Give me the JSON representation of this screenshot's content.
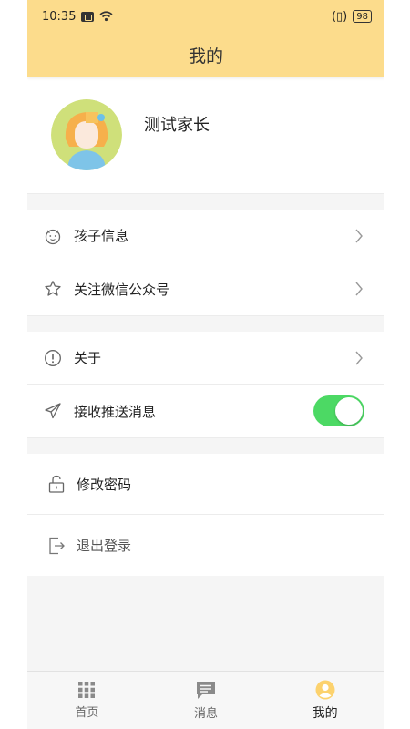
{
  "status_bar": {
    "time": "10:35",
    "battery": "98"
  },
  "header": {
    "title": "我的"
  },
  "profile": {
    "name": "测试家长"
  },
  "menu_group_1": [
    {
      "label": "孩子信息",
      "icon": "child-face-icon"
    },
    {
      "label": "关注微信公众号",
      "icon": "star-icon"
    }
  ],
  "menu_group_2": [
    {
      "label": "关于",
      "icon": "info-exclamation-icon"
    },
    {
      "label": "接收推送消息",
      "icon": "paper-plane-icon",
      "toggle_on": true
    }
  ],
  "menu_group_3": [
    {
      "label": "修改密码",
      "icon": "unlock-icon"
    },
    {
      "label": "退出登录",
      "icon": "logout-icon"
    }
  ],
  "tab_bar": {
    "tabs": [
      {
        "label": "首页",
        "icon": "grid-icon"
      },
      {
        "label": "消息",
        "icon": "message-icon"
      },
      {
        "label": "我的",
        "icon": "profile-icon",
        "active": true
      }
    ]
  },
  "colors": {
    "accent": "#fcdc8c",
    "toggle": "#4cd964",
    "active_tab": "#fcd26e"
  }
}
